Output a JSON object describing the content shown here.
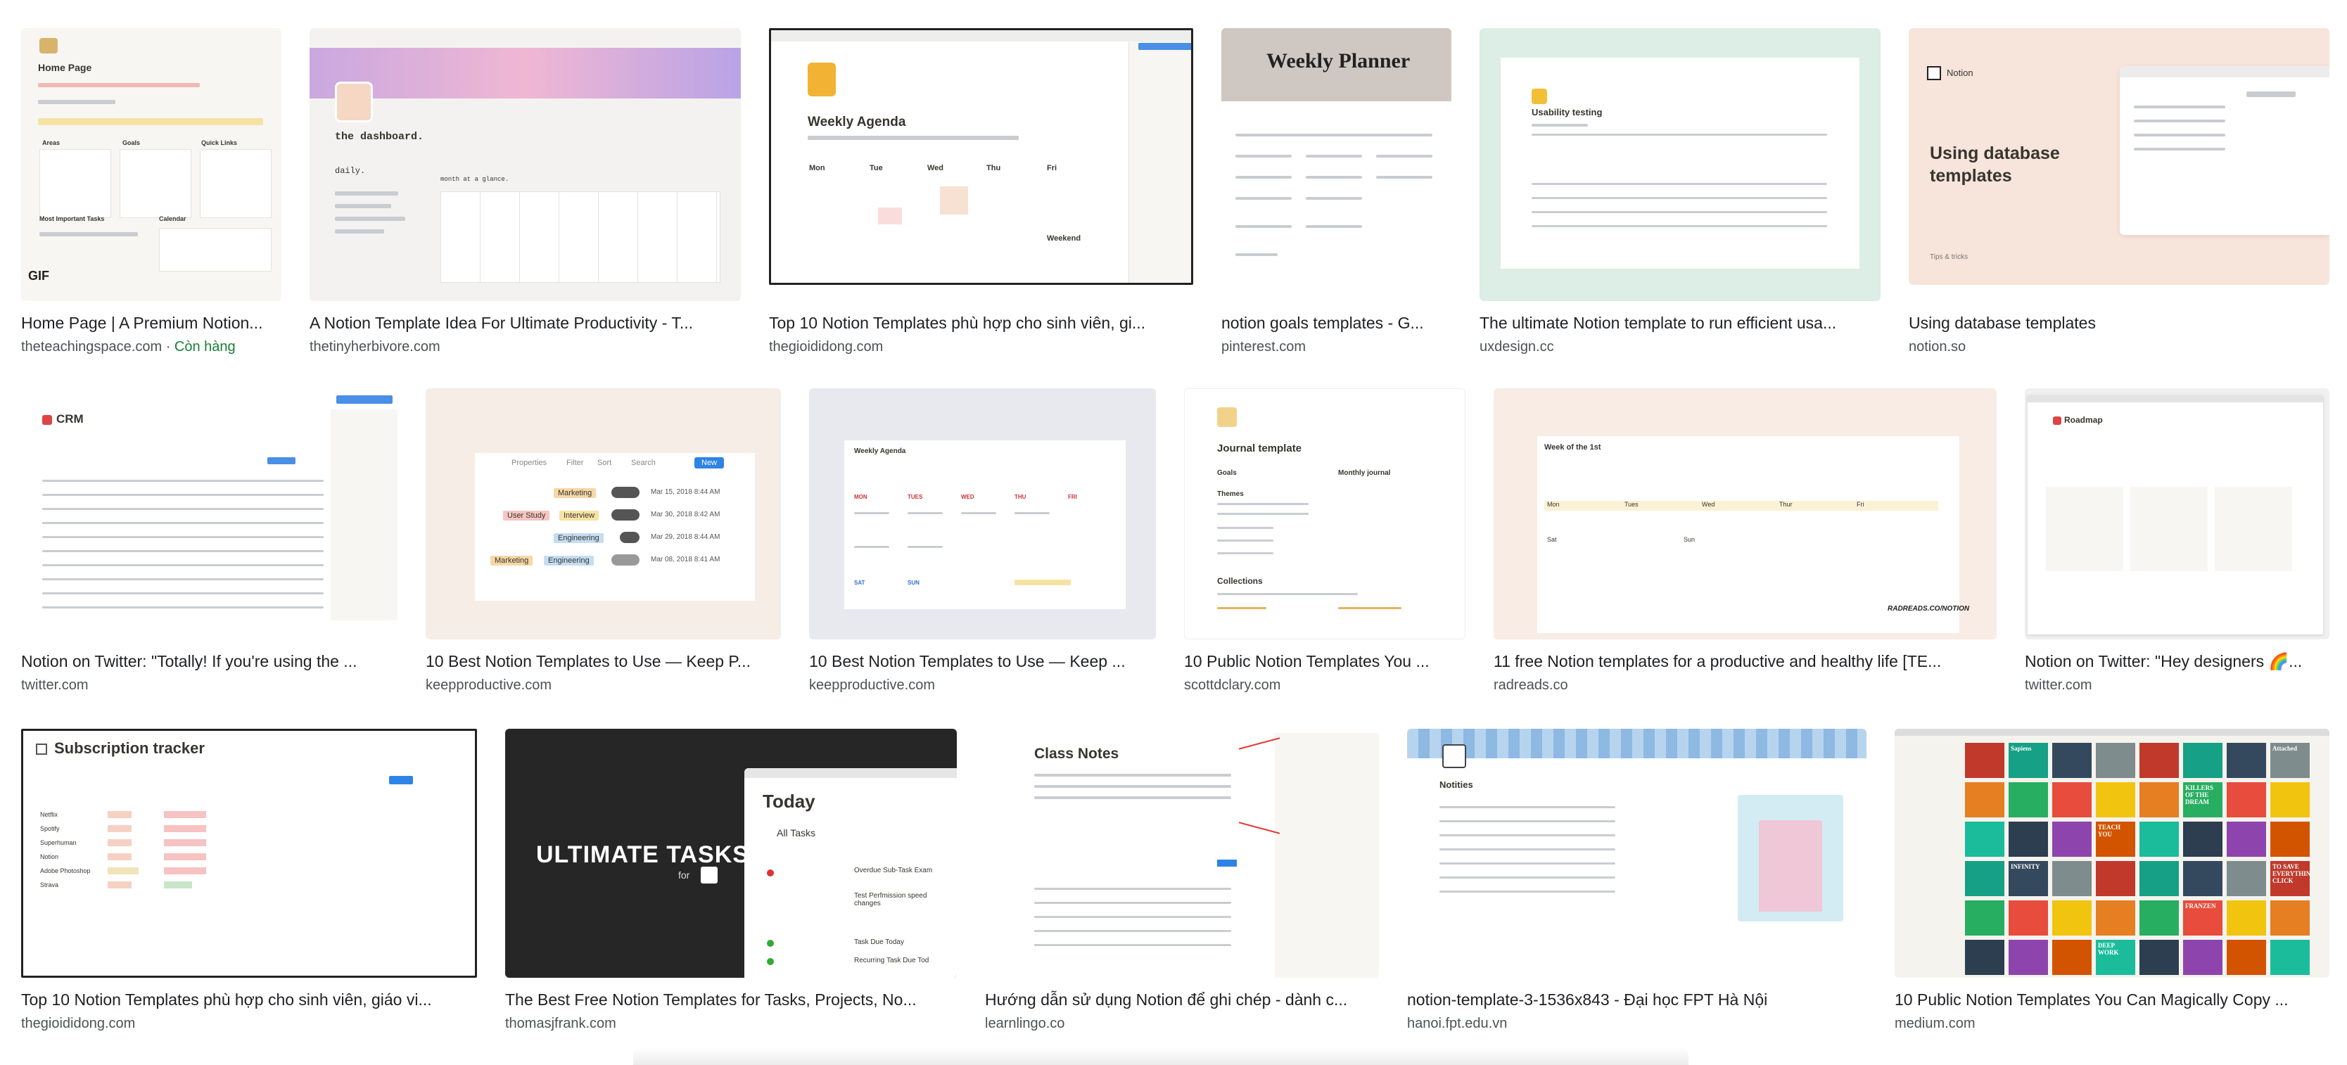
{
  "results": [
    {
      "title": "Home Page | A Premium Notion...",
      "source": "theteachingspace.com",
      "stock": "Còn hàng",
      "thumb": {
        "heading": "Home Page",
        "badge": "GIF",
        "cols": [
          "Areas",
          "Goals",
          "Quick Links"
        ],
        "sub": [
          "Most Important Tasks",
          "Calendar"
        ]
      }
    },
    {
      "title": "A Notion Template Idea For Ultimate Productivity - T...",
      "source": "thetinyherbivore.com",
      "thumb": {
        "heading": "the dashboard.",
        "sub": "daily.",
        "note": "month at a glance."
      }
    },
    {
      "title": "Top 10 Notion Templates phù hợp cho sinh viên, gi...",
      "source": "thegioididong.com",
      "thumb": {
        "heading": "Weekly Agenda",
        "days": [
          "Mon",
          "Tue",
          "Wed",
          "Thu",
          "Fri"
        ],
        "extra": "Weekend"
      }
    },
    {
      "title": "notion goals templates - G...",
      "source": "pinterest.com",
      "thumb": {
        "heading": "Weekly Planner"
      }
    },
    {
      "title": "The ultimate Notion template to run efficient usa...",
      "source": "uxdesign.cc",
      "thumb": {
        "heading": "Usability testing"
      }
    },
    {
      "title": "Using database templates",
      "source": "notion.so",
      "thumb": {
        "brand": "Notion",
        "heading": "Using database templates",
        "footer": "Tips & tricks"
      }
    },
    {
      "title": "Notion on Twitter: \"Totally! If you're using the ...",
      "source": "twitter.com",
      "thumb": {
        "heading": "CRM"
      }
    },
    {
      "title": "10 Best Notion Templates to Use — Keep P...",
      "source": "keepproductive.com",
      "thumb": {
        "toolbar": [
          "Properties",
          "Filter",
          "Sort",
          "Search",
          "New"
        ],
        "rows": [
          {
            "tags": [
              "Marketing"
            ],
            "date": "Mar 15, 2018 8:44 AM"
          },
          {
            "tags": [
              "User Study",
              "Interview"
            ],
            "date": "Mar 30, 2018 8:42 AM"
          },
          {
            "tags": [
              "Engineering"
            ],
            "date": "Mar 29, 2018 8:44 AM"
          },
          {
            "tags": [
              "Marketing",
              "Engineering"
            ],
            "date": "Mar 08, 2018 8:41 AM"
          }
        ]
      }
    },
    {
      "title": "10 Best Notion Templates to Use — Keep ...",
      "source": "keepproductive.com",
      "thumb": {
        "heading": "Weekly Agenda",
        "days": [
          "MON",
          "TUES",
          "WED",
          "THU",
          "FRI"
        ],
        "bottom": [
          "SAT",
          "SUN"
        ]
      }
    },
    {
      "title": "10 Public Notion Templates You ...",
      "source": "scottdclary.com",
      "thumb": {
        "heading": "Journal template",
        "left": "Goals",
        "right": "Monthly journal",
        "themes": "Themes",
        "collections": "Collections"
      }
    },
    {
      "title": "11 free Notion templates for a productive and healthy life [TE...",
      "source": "radreads.co",
      "thumb": {
        "heading": "Week of the 1st",
        "days": [
          "Mon",
          "Tues",
          "Wed",
          "Thur",
          "Fri"
        ],
        "weekend": [
          "Sat",
          "Sun"
        ],
        "watermark": "RADREADS.CO/NOTION"
      }
    },
    {
      "title": "Notion on Twitter: \"Hey designers 🌈...",
      "source": "twitter.com",
      "thumb": {
        "heading": "Roadmap"
      }
    },
    {
      "title": "Top 10 Notion Templates phù hợp cho sinh viên, giáo vi...",
      "source": "thegioididong.com",
      "thumb": {
        "heading": "Subscription tracker",
        "rows": [
          "Netflix",
          "Spotify",
          "Superhuman",
          "Notion",
          "Adobe Photoshop",
          "Strava"
        ]
      }
    },
    {
      "title": "The Best Free Notion Templates for Tasks, Projects, No...",
      "source": "thomasjfrank.com",
      "thumb": {
        "brand": "ULTIMATE TASKS",
        "sub": "for",
        "heading": "Today",
        "tab": "All Tasks",
        "tasks": [
          "Overdue Sub-Task Exam",
          "Test Perfmission speed changes",
          "Task Due Today",
          "Recurring Task Due Tod"
        ]
      }
    },
    {
      "title": "Hướng dẫn sử dụng Notion để ghi chép - dành c...",
      "source": "learnlingo.co",
      "thumb": {
        "heading": "Class Notes"
      }
    },
    {
      "title": "notion-template-3-1536x843 - Đại học FPT Hà Nội",
      "source": "hanoi.fpt.edu.vn",
      "thumb": {
        "heading": "Notities"
      }
    },
    {
      "title": "10 Public Notion Templates You Can Magically Copy ...",
      "source": "medium.com",
      "thumb": {
        "books": [
          "Sapiens",
          "Attached",
          "KILLERS OF THE DREAM",
          "TEACH YOU",
          "INFINITY",
          "TO SAVE EVERYTHING CLICK",
          "FRANZEN",
          "DEEP WORK"
        ]
      }
    }
  ],
  "colors": {
    "title": "#202124",
    "source": "#4d5156",
    "stock": "#188038"
  }
}
